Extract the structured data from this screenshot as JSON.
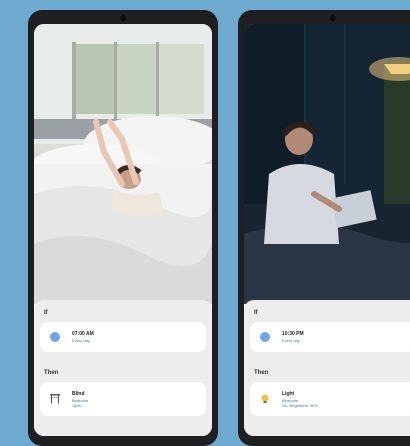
{
  "left_phone": {
    "if_label": "If",
    "then_label": "Then",
    "trigger": {
      "time": "07:00 AM",
      "detail": "Every day",
      "icon": "clock-icon"
    },
    "action": {
      "name": "Blind",
      "room": "Bedroom",
      "state": "Open",
      "icon": "blind-icon"
    }
  },
  "right_phone": {
    "if_label": "If",
    "then_label": "Then",
    "trigger": {
      "time": "10:30 PM",
      "detail": "Every day",
      "icon": "clock-icon"
    },
    "action": {
      "name": "Light",
      "room": "Bedroom",
      "state": "On, Brightness 30%",
      "icon": "bulb-icon"
    }
  },
  "colors": {
    "background": "#6ea9d0",
    "accent": "#3f6fd1",
    "clock": "#6aa9e6",
    "bulb": "#f2c23a"
  }
}
